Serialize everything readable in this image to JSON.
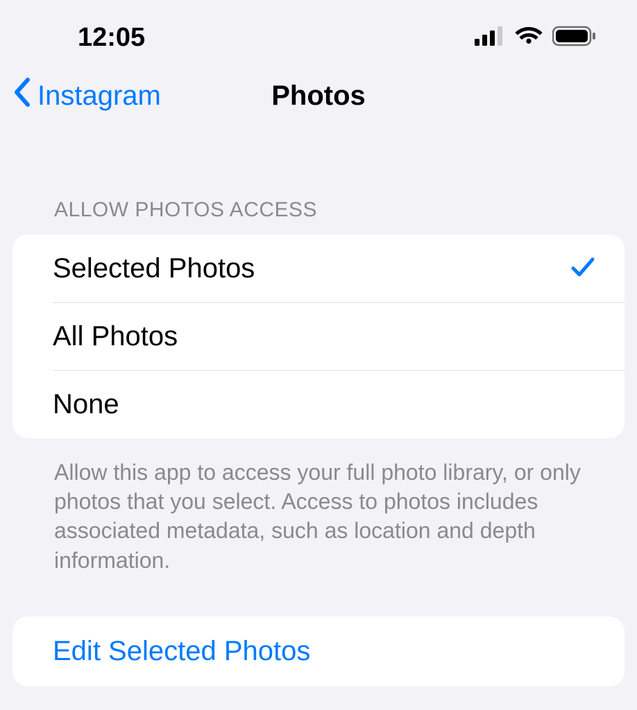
{
  "status": {
    "time": "12:05"
  },
  "nav": {
    "back_label": "Instagram",
    "title": "Photos"
  },
  "section": {
    "header": "ALLOW PHOTOS ACCESS",
    "footer": "Allow this app to access your full photo library, or only photos that you select. Access to photos includes associated metadata, such as location and depth information."
  },
  "options": {
    "selected_photos": "Selected Photos",
    "all_photos": "All Photos",
    "none": "None",
    "selected_index": 0
  },
  "action": {
    "edit_label": "Edit Selected Photos"
  }
}
